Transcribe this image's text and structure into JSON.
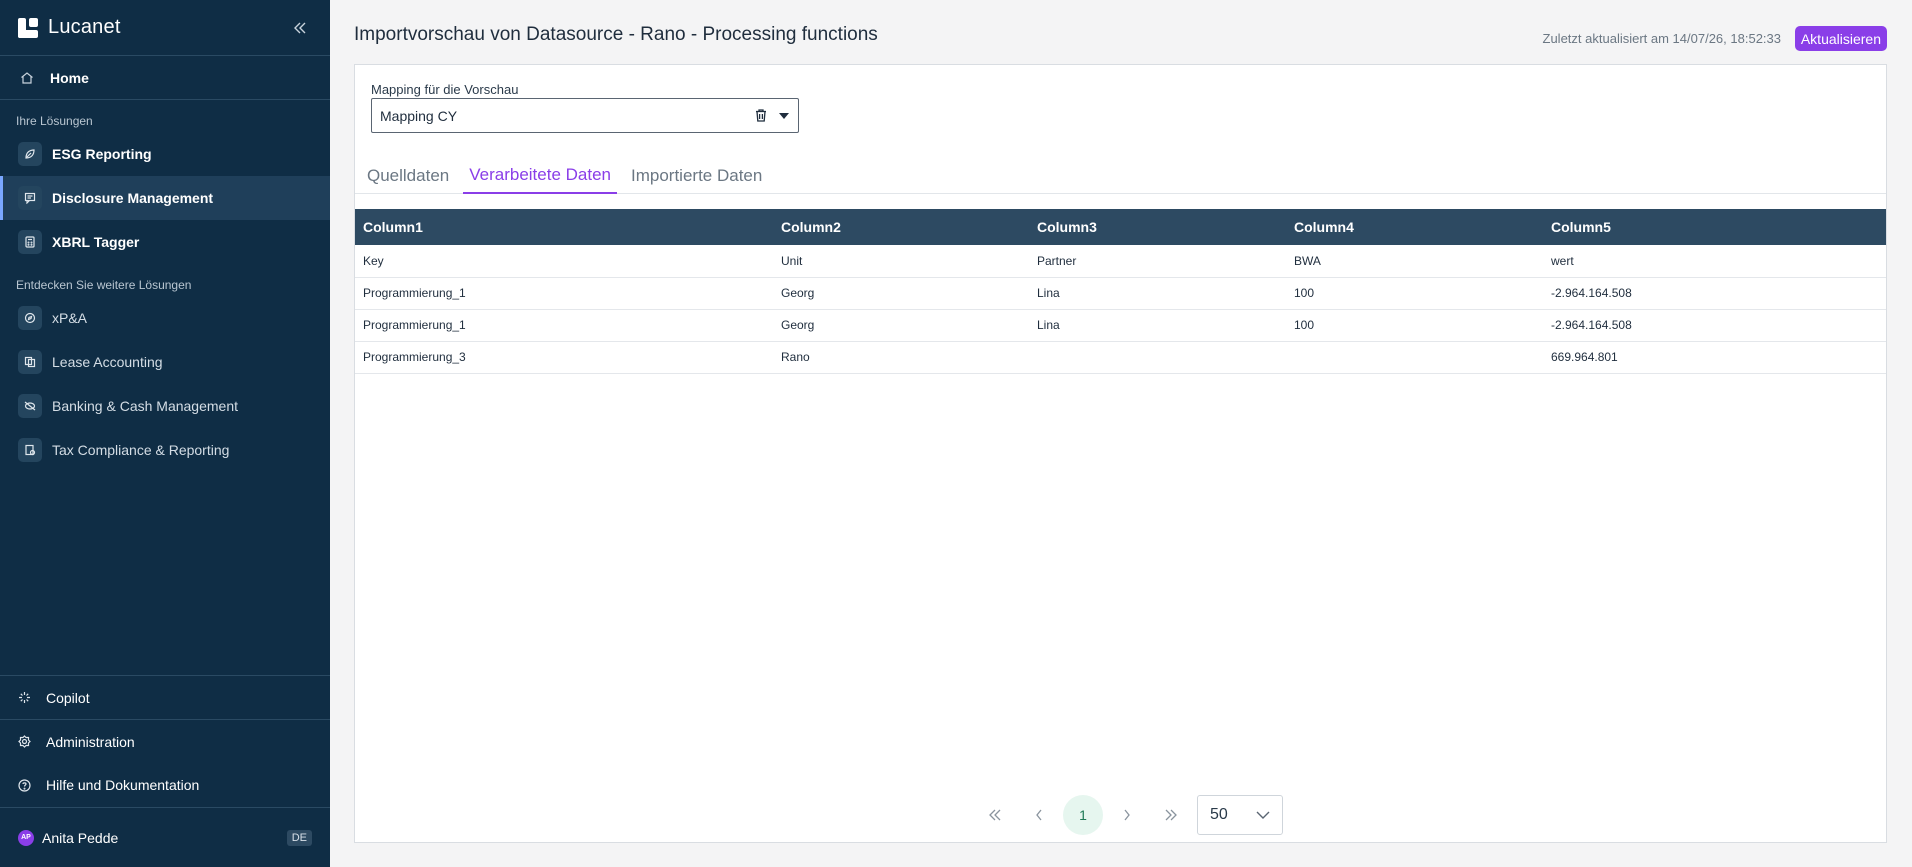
{
  "app": {
    "name": "Lucanet"
  },
  "sidebar": {
    "home": "Home",
    "section_solutions": "Ihre Lösungen",
    "solutions": [
      {
        "label": "ESG Reporting",
        "icon": "leaf-icon"
      },
      {
        "label": "Disclosure Management",
        "icon": "message-icon",
        "active": true
      },
      {
        "label": "XBRL Tagger",
        "icon": "calculator-icon"
      }
    ],
    "section_discover": "Entdecken Sie weitere Lösungen",
    "discover": [
      {
        "label": "xP&A",
        "icon": "compass-icon"
      },
      {
        "label": "Lease Accounting",
        "icon": "documents-icon"
      },
      {
        "label": "Banking & Cash Management",
        "icon": "bank-icon"
      },
      {
        "label": "Tax Compliance & Reporting",
        "icon": "tax-icon"
      }
    ],
    "bottom": {
      "copilot": "Copilot",
      "administration": "Administration",
      "help": "Hilfe und Dokumentation"
    },
    "user": {
      "initials": "AP",
      "name": "Anita Pedde",
      "language": "DE"
    }
  },
  "header": {
    "title": "Importvorschau von Datasource - Rano - Processing functions",
    "updated": "Zuletzt aktualisiert am 14/07/26, 18:52:33",
    "refresh_label": "Aktualisieren"
  },
  "mapping": {
    "label": "Mapping für die Vorschau",
    "value": "Mapping CY"
  },
  "tabs": [
    {
      "label": "Quelldaten",
      "active": false
    },
    {
      "label": "Verarbeitete Daten",
      "active": true
    },
    {
      "label": "Importierte Daten",
      "active": false
    }
  ],
  "table": {
    "columns": [
      "Column1",
      "Column2",
      "Column3",
      "Column4",
      "Column5"
    ],
    "rows": [
      [
        "Key",
        "Unit",
        "Partner",
        "BWA",
        "wert"
      ],
      [
        "Programmierung_1",
        "Georg",
        "Lina",
        "100",
        "-2.964.164.508"
      ],
      [
        "Programmierung_1",
        "Georg",
        "Lina",
        "100",
        "-2.964.164.508"
      ],
      [
        "Programmierung_3",
        "Rano",
        "",
        "",
        "669.964.801"
      ]
    ]
  },
  "pagination": {
    "current_page": "1",
    "page_size": "50"
  },
  "colors": {
    "sidebar": "#0f2d45",
    "accent": "#8a3ee8",
    "table_header": "#2d4a62"
  }
}
